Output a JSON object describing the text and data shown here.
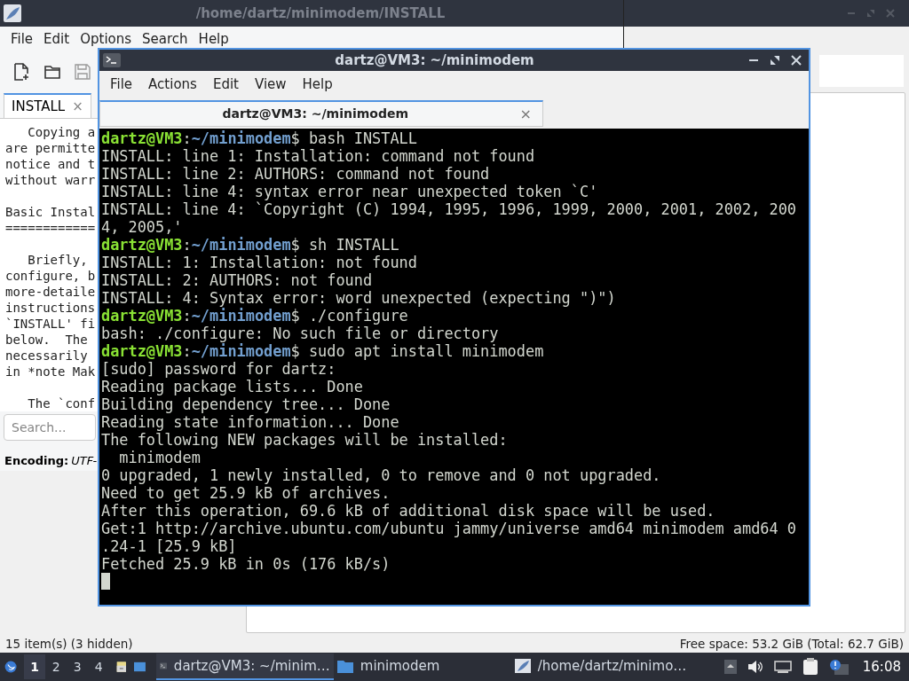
{
  "file_manager": {
    "status_left": "15 item(s) (3 hidden)",
    "status_right": "Free space: 53.2 GiB (Total: 62.7 GiB)"
  },
  "editor": {
    "title": "/home/dartz/minimodem/INSTALL",
    "menu": [
      "File",
      "Edit",
      "Options",
      "Search",
      "Help"
    ],
    "tab": {
      "label": "INSTALL",
      "close": "×"
    },
    "paragraphs": [
      [
        "   Copying a",
        "are permitte",
        "notice and t",
        "without warr"
      ],
      [
        "Basic Instal",
        "============"
      ],
      [
        "   Briefly, ",
        "configure, b",
        "more-detaile",
        "instructions",
        "`INSTALL' fi",
        "below.  The ",
        "necessarily ",
        "in *note Mak"
      ],
      [
        "   The `conf"
      ]
    ],
    "search": {
      "placeholder": "Search..."
    },
    "encoding_label": "Encoding:",
    "encoding_value": "UTF-"
  },
  "terminal": {
    "title": "dartz@VM3: ~/minimodem",
    "menu": [
      "File",
      "Actions",
      "Edit",
      "View",
      "Help"
    ],
    "tab": {
      "label": "dartz@VM3: ~/minimodem",
      "close": "×"
    },
    "lines": [
      {
        "kind": "prompt",
        "user": "dartz@VM3",
        "sep": ":",
        "path": "~/minimodem",
        "symbol": "$",
        "command": " bash INSTALL"
      },
      {
        "kind": "output",
        "text": "INSTALL: line 1: Installation: command not found"
      },
      {
        "kind": "output",
        "text": "INSTALL: line 2: AUTHORS: command not found"
      },
      {
        "kind": "output",
        "text": "INSTALL: line 4: syntax error near unexpected token `C'"
      },
      {
        "kind": "output",
        "text": "INSTALL: line 4: `Copyright (C) 1994, 1995, 1996, 1999, 2000, 2001, 2002, 200"
      },
      {
        "kind": "output",
        "text": "4, 2005,'"
      },
      {
        "kind": "prompt",
        "user": "dartz@VM3",
        "sep": ":",
        "path": "~/minimodem",
        "symbol": "$",
        "command": " sh INSTALL"
      },
      {
        "kind": "output",
        "text": "INSTALL: 1: Installation: not found"
      },
      {
        "kind": "output",
        "text": "INSTALL: 2: AUTHORS: not found"
      },
      {
        "kind": "output",
        "text": "INSTALL: 4: Syntax error: word unexpected (expecting \")\")"
      },
      {
        "kind": "prompt",
        "user": "dartz@VM3",
        "sep": ":",
        "path": "~/minimodem",
        "symbol": "$",
        "command": " ./configure"
      },
      {
        "kind": "output",
        "text": "bash: ./configure: No such file or directory"
      },
      {
        "kind": "prompt",
        "user": "dartz@VM3",
        "sep": ":",
        "path": "~/minimodem",
        "symbol": "$",
        "command": " sudo apt install minimodem"
      },
      {
        "kind": "output",
        "text": "[sudo] password for dartz:"
      },
      {
        "kind": "output",
        "text": "Reading package lists... Done"
      },
      {
        "kind": "output",
        "text": "Building dependency tree... Done"
      },
      {
        "kind": "output",
        "text": "Reading state information... Done"
      },
      {
        "kind": "output",
        "text": "The following NEW packages will be installed:"
      },
      {
        "kind": "output",
        "text": "  minimodem"
      },
      {
        "kind": "output",
        "text": "0 upgraded, 1 newly installed, 0 to remove and 0 not upgraded."
      },
      {
        "kind": "output",
        "text": "Need to get 25.9 kB of archives."
      },
      {
        "kind": "output",
        "text": "After this operation, 69.6 kB of additional disk space will be used."
      },
      {
        "kind": "output",
        "text": "Get:1 http://archive.ubuntu.com/ubuntu jammy/universe amd64 minimodem amd64 0"
      },
      {
        "kind": "output",
        "text": ".24-1 [25.9 kB]"
      },
      {
        "kind": "output",
        "text": "Fetched 25.9 kB in 0s (176 kB/s)"
      },
      {
        "kind": "cursor"
      }
    ]
  },
  "taskbar": {
    "workspaces": [
      {
        "label": "1",
        "selected": true
      },
      {
        "label": "2",
        "selected": false
      },
      {
        "label": "3",
        "selected": false
      },
      {
        "label": "4",
        "selected": false
      }
    ],
    "tasks": [
      {
        "kind": "terminal",
        "label": "dartz@VM3: ~/minim…",
        "selected": true
      },
      {
        "kind": "folder",
        "label": "minimodem",
        "selected": false
      },
      {
        "kind": "editor",
        "label": "/home/dartz/minimo…",
        "selected": false
      }
    ],
    "clock": "16:08"
  }
}
